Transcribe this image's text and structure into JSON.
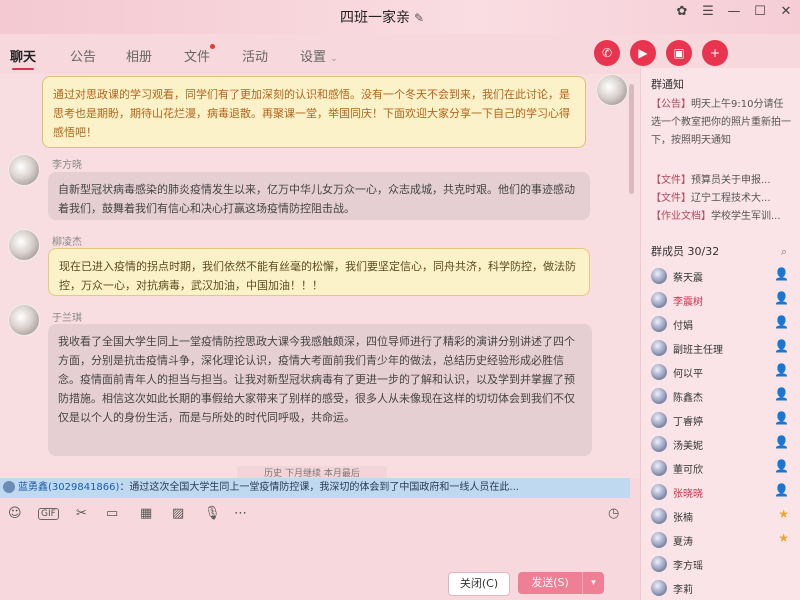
{
  "window": {
    "title": "四班一家亲",
    "title_edit_icon": "pencil-icon",
    "controls": [
      "skin-icon",
      "menu-icon",
      "minimize-icon",
      "maximize-icon",
      "close-icon"
    ]
  },
  "tabs": [
    {
      "label": "聊天",
      "active": true
    },
    {
      "label": "公告"
    },
    {
      "label": "相册"
    },
    {
      "label": "文件",
      "badge": true
    },
    {
      "label": "活动"
    },
    {
      "label": "设置",
      "has_dropdown": true
    }
  ],
  "call_buttons": [
    "phone-icon",
    "video-icon",
    "screen-share-icon",
    "add-app-icon"
  ],
  "messages": [
    {
      "name": "",
      "text": "通过对思政课的学习观看，同学们有了更加深刻的认识和感悟。没有一个冬天不会到来，我们在此讨论，是思考也是期盼，期待山花烂漫，病毒退散。再聚课一堂，举国同庆！下面欢迎大家分享一下自己的学习心得感悟吧！"
    },
    {
      "name": "李方晓",
      "text": "自新型冠状病毒感染的肺炎疫情发生以来，亿万中华儿女万众一心，众志成城，共克时艰。他们的事迹感动着我们，鼓舞着我们有信心和决心打赢这场疫情防控阻击战。"
    },
    {
      "name": "柳凌杰",
      "text": "现在已进入疫情的拐点时期，我们依然不能有丝毫的松懈，我们要坚定信心，同舟共济，科学防控，做法防控，万众一心，对抗病毒，武汉加油，中国加油！！！"
    },
    {
      "name": "于兰琪",
      "text": "我收看了全国大学生同上一堂疫情防控思政大课今我感触颇深，四位导师进行了精彩的演讲分别讲述了四个方面，分别是抗击疫情斗争，深化理论认识，疫情大考面前我们青少年的做法，总结历史经验形成必胜信念。疫情面前青年人的担当与担当。让我对新型冠状病毒有了更进一步的了解和认识，以及学到并掌握了预防措施。相信这次如此长期的事假给大家带来了别样的感受，很多人从未像现在这样的切切体会到我们不仅仅是以个人的身份生活，而是与所处的时代同呼吸，共命运。"
    }
  ],
  "history_note": "历史   下月继续   本月最后",
  "notice_strip": {
    "name": "蓝勇鑫(3029841866)",
    "text": "：通过这次全国大学生同上一堂疫情防控课，我深切的体会到了中国政府和一线人员在此..."
  },
  "toolbar": [
    "emoji-icon",
    "gif-icon",
    "scissors-icon",
    "folder-icon",
    "image-icon",
    "gallery-icon",
    "microphone-icon",
    "more-icon"
  ],
  "toolbar_gif": "GIF",
  "toolbar_history_icon": "clock-icon",
  "buttons": {
    "close": "关闭(C)",
    "send": "发送(S)"
  },
  "sidebar": {
    "notice_title": "群通知",
    "announcements": [
      {
        "tag": "【公告】",
        "text": "明天上午9:10分请任选一个教室把你的照片重新拍一下，按照明天通知"
      },
      {
        "tag": "【文件】",
        "text": "预算员关于申报..."
      },
      {
        "tag": "【文件】",
        "text": "辽宁工程技术大..."
      },
      {
        "tag": "【作业文档】",
        "text": "学校学生军训..."
      }
    ],
    "members_title": "群成员 30/32",
    "members": [
      {
        "name": "蔡天震",
        "role": "admin"
      },
      {
        "name": "李震树",
        "role": "admin",
        "red": true
      },
      {
        "name": "付娟",
        "role": "admin"
      },
      {
        "name": "副班主任理",
        "role": "admin"
      },
      {
        "name": "何以平",
        "role": "admin"
      },
      {
        "name": "陈鑫杰",
        "role": "admin"
      },
      {
        "name": "丁睿婷",
        "role": "admin"
      },
      {
        "name": "汤美妮",
        "role": "admin"
      },
      {
        "name": "董可欣",
        "role": "admin"
      },
      {
        "name": "张晓晓",
        "role": "owner",
        "red": true
      },
      {
        "name": "张楠",
        "role": "star"
      },
      {
        "name": "夏涛",
        "role": "star"
      },
      {
        "name": "李方瑶",
        "role": ""
      },
      {
        "name": "李莉",
        "role": ""
      }
    ]
  }
}
